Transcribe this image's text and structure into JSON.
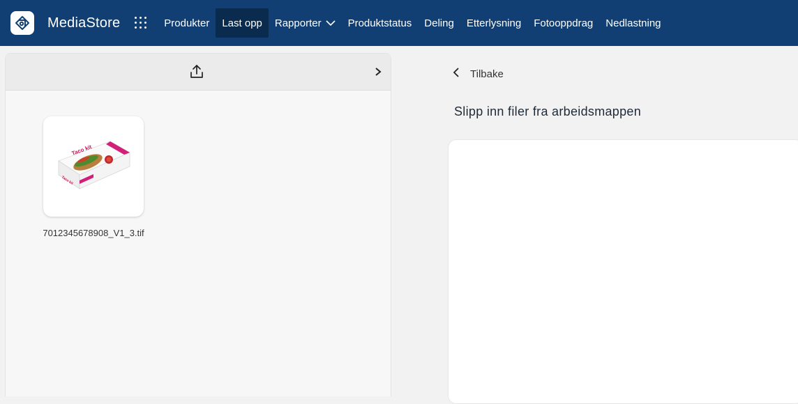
{
  "app": {
    "name": "MediaStore"
  },
  "nav": {
    "items": [
      {
        "label": "Produkter"
      },
      {
        "label": "Last opp"
      },
      {
        "label": "Rapporter"
      },
      {
        "label": "Produktstatus"
      },
      {
        "label": "Deling"
      },
      {
        "label": "Etterlysning"
      },
      {
        "label": "Fotooppdrag"
      },
      {
        "label": "Nedlastning"
      }
    ],
    "active_item": "Last opp"
  },
  "left_panel": {
    "file": {
      "name": "7012345678908_V1_3.tif",
      "thumbnail_product_text": "Taco kit"
    }
  },
  "main": {
    "back_label": "Tilbake",
    "drop_title": "Slipp inn filer fra arbeidsmappen"
  },
  "colors": {
    "topbar": "#123f73",
    "nav_active": "#0a2a4e",
    "accent_magenta": "#d21f78"
  }
}
